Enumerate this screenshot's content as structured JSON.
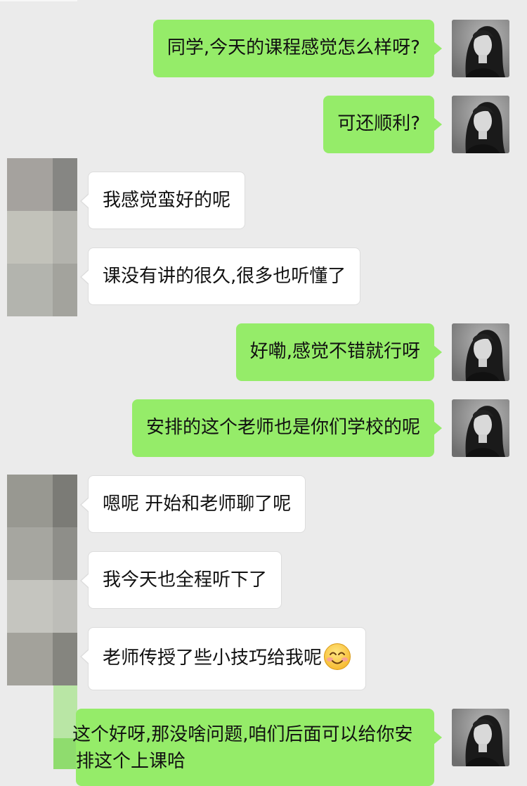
{
  "chat": {
    "messages": [
      {
        "side": "right",
        "text": "同学,今天的课程感觉怎么样呀?"
      },
      {
        "side": "right",
        "text": "可还顺利?"
      },
      {
        "side": "left",
        "text": "我感觉蛮好的呢"
      },
      {
        "side": "left",
        "text": "课没有讲的很久,很多也听懂了"
      },
      {
        "side": "right",
        "text": "好嘞,感觉不错就行呀"
      },
      {
        "side": "right",
        "text": "安排的这个老师也是你们学校的呢"
      },
      {
        "side": "left",
        "text": "嗯呢 开始和老师聊了呢"
      },
      {
        "side": "left",
        "text": "我今天也全程听下了"
      },
      {
        "side": "left",
        "text": "老师传授了些小技巧给我呢",
        "emoji": "smiling-blush-emoji"
      },
      {
        "side": "right",
        "text": "这个好呀,那没啥问题,咱们后面可以给你安排这个上课哈"
      }
    ]
  },
  "colors": {
    "background": "#ebebeb",
    "bubble_self": "#95ec69",
    "bubble_other": "#ffffff"
  }
}
